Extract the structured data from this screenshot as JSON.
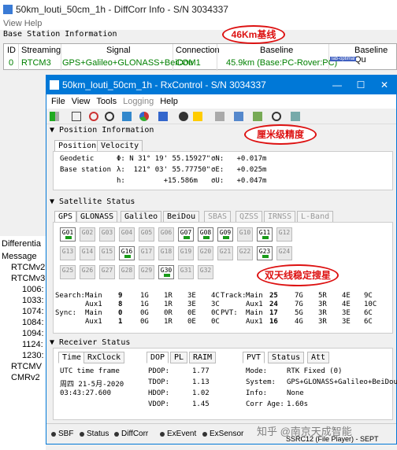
{
  "back": {
    "title": "50km_louti_50cm_1h - DiffCorr Info - S/N 3034337",
    "menu": "View   Help",
    "base_station_label": "Base Station Information",
    "columns": [
      "ID",
      "Streaming",
      "Signal",
      "Connection",
      "Baseline",
      "Baseline Qu"
    ],
    "row": [
      "0",
      "RTCM3",
      "GPS+Galileo+GLONASS+BeiDou",
      "COM1",
      "45.9km (Base:PC-Rover:PC)",
      "lab-optimal"
    ],
    "left_header": "Differentia",
    "left_items": [
      "Message",
      "RTCMv2",
      "RTCMv3",
      "1006:",
      "1033:",
      "1074:",
      "1084:",
      "1094:",
      "1124:",
      "1230:",
      "RTCMV",
      "CMRv2"
    ]
  },
  "win": {
    "title": "50km_louti_50cm_1h - RxControl - S/N 3034337",
    "menu": [
      "File",
      "View",
      "Tools",
      "Logging",
      "Help"
    ],
    "position": {
      "header": "Position Information",
      "tabs": [
        "Position",
        "Velocity"
      ],
      "geodetic_label": "Geodetic",
      "phi": "Φ: N 31° 19' 55.15927\"",
      "sigma_n": "σN:   +0.017m",
      "base_label": "Base station",
      "lambda": "λ:  121° 03' 55.77750\"",
      "sigma_e": "σE:   +0.025m",
      "h": "h:         +15.586m",
      "sigma_u": "σU:   +0.047m"
    },
    "satellite": {
      "header": "Satellite Status",
      "tabs": [
        "GPS",
        "GLONASS",
        "Galileo",
        "BeiDou",
        "SBAS",
        "QZSS",
        "IRNSS",
        "L-Band"
      ],
      "rows": [
        [
          "G01",
          "G02",
          "G03",
          "G04",
          "G05",
          "G06",
          "G07",
          "G08",
          "G09",
          "G10",
          "G11",
          "G12"
        ],
        [
          "G13",
          "G14",
          "G15",
          "G16",
          "G17",
          "G18",
          "G19",
          "G20",
          "G21",
          "G22",
          "G23",
          "G24"
        ],
        [
          "G25",
          "G26",
          "G27",
          "G28",
          "G29",
          "G30",
          "G31",
          "G32"
        ]
      ],
      "active": [
        "G01",
        "G07",
        "G08",
        "G09",
        "G11",
        "G16",
        "G23",
        "G30"
      ],
      "search_label": "Search:",
      "sync_label": "Sync:",
      "track_label": "Track:",
      "pvt_label": "PVT:",
      "search_main": [
        "Main",
        "9",
        "1G",
        "1R",
        "3E",
        "4C"
      ],
      "search_aux": [
        "Aux1",
        "8",
        "1G",
        "1R",
        "3E",
        "3C"
      ],
      "sync_main": [
        "Main",
        "0",
        "0G",
        "0R",
        "0E",
        "0C"
      ],
      "sync_aux": [
        "Aux1",
        "1",
        "0G",
        "1R",
        "0E",
        "0C"
      ],
      "track_main": [
        "Main",
        "25",
        "7G",
        "5R",
        "4E",
        "9C"
      ],
      "track_aux": [
        "Aux1",
        "24",
        "7G",
        "3R",
        "4E",
        "10C"
      ],
      "pvt_main": [
        "Main",
        "17",
        "5G",
        "3R",
        "3E",
        "6C"
      ],
      "pvt_aux": [
        "Aux1",
        "16",
        "4G",
        "3R",
        "3E",
        "6C"
      ]
    },
    "receiver": {
      "header": "Receiver Status",
      "time_tabs": [
        "Time",
        "RxClock"
      ],
      "utc_label": "UTC time frame",
      "date": "周四 21-5月-2020",
      "time": "03:43:27.600",
      "dop_tabs": [
        "DOP",
        "PL",
        "RAIM"
      ],
      "dop": [
        [
          "PDOP:",
          "1.77"
        ],
        [
          "TDOP:",
          "1.13"
        ],
        [
          "HDOP:",
          "1.02"
        ],
        [
          "VDOP:",
          "1.45"
        ]
      ],
      "pvt_tabs": [
        "PVT",
        "Status",
        "Att"
      ],
      "pvt": [
        [
          "Mode:",
          "RTK Fixed (0)"
        ],
        [
          "System:",
          "GPS+GLONASS+Galileo+BeiDou"
        ],
        [
          "Info:",
          "None"
        ],
        [
          "Corr Age:",
          "1.60s"
        ]
      ]
    },
    "statusbar": [
      "SBF",
      "Status",
      "DiffCorr",
      "ExEvent",
      "ExSensor"
    ],
    "status_right": "SSRC12 (File Player) - SEPT"
  },
  "annotations": [
    "46Km基线",
    "厘米级精度",
    "双天线稳定搜星"
  ],
  "watermark": "知乎 @南京天成智能"
}
